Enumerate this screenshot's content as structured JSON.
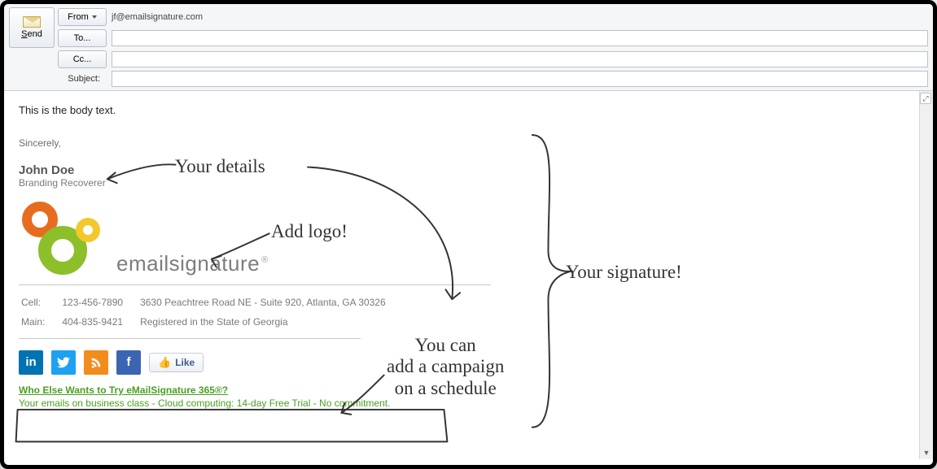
{
  "header": {
    "send_label": "Send",
    "from_label": "From",
    "from_value": "jf@emailsignature.com",
    "to_label": "To...",
    "to_value": "",
    "cc_label": "Cc...",
    "cc_value": "",
    "subject_label": "Subject:",
    "subject_value": ""
  },
  "body": {
    "text": "This is the body text.",
    "signoff": "Sincerely,"
  },
  "signature": {
    "name": "John Doe",
    "title": "Branding Recoverer",
    "brand": "emailsignature",
    "brand_mark": "®",
    "contact": {
      "cell_label": "Cell:",
      "cell": "123-456-7890",
      "main_label": "Main:",
      "main": "404-835-9421",
      "address": "3630 Peachtree Road NE - Suite 920, Atlanta, GA 30326",
      "registered": "Registered in the State of Georgia"
    },
    "social": {
      "linkedin": "in",
      "twitter": "t",
      "rss": "rss",
      "facebook": "f",
      "like_label": "Like"
    },
    "campaign": {
      "headline": "Who Else Wants to Try eMailSignature 365®?",
      "subline": "Your emails on business class - Cloud computing: 14-day Free Trial - No commitment."
    }
  },
  "annotations": {
    "details": "Your details",
    "add_logo": "Add logo!",
    "your_signature": "Your signature!",
    "campaign_note_l1": "You can",
    "campaign_note_l2": "add a campaign",
    "campaign_note_l3": "on a schedule"
  }
}
